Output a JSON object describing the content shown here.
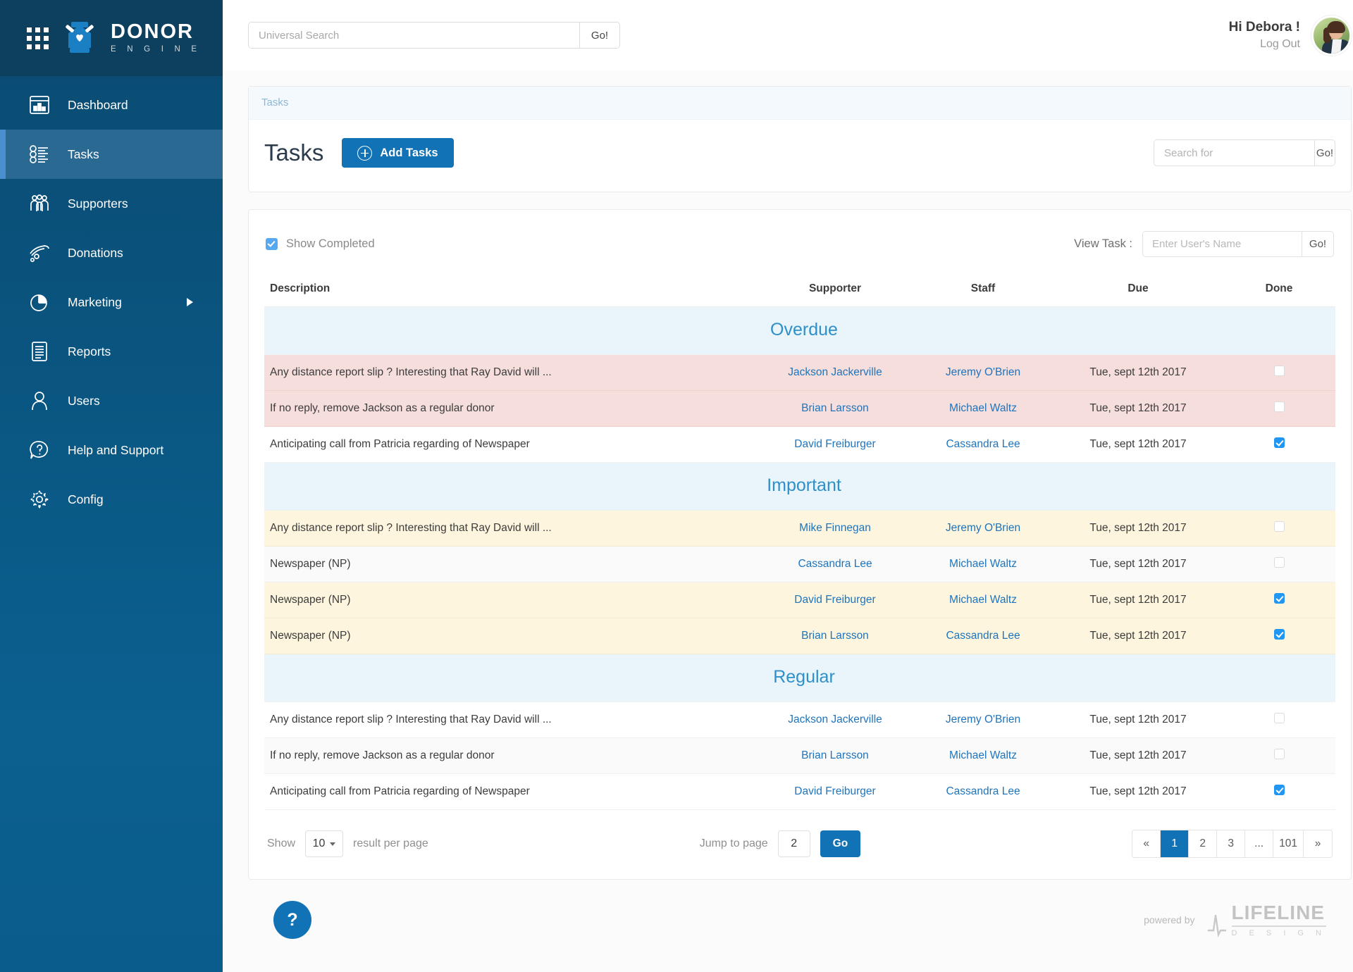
{
  "brand": {
    "name": "DONOR",
    "subtitle": "E N G I N E",
    "grid_icon": "apps-grid-icon",
    "logo_icon": "donor-engine-logo-icon"
  },
  "sidebar": {
    "items": [
      {
        "label": "Dashboard",
        "icon": "dashboard-icon",
        "active": false,
        "arrow": false
      },
      {
        "label": "Tasks",
        "icon": "tasks-list-icon",
        "active": true,
        "arrow": false
      },
      {
        "label": "Supporters",
        "icon": "people-group-icon",
        "active": false,
        "arrow": false
      },
      {
        "label": "Donations",
        "icon": "hand-coin-icon",
        "active": false,
        "arrow": false
      },
      {
        "label": "Marketing",
        "icon": "pie-chart-icon",
        "active": false,
        "arrow": true
      },
      {
        "label": "Reports",
        "icon": "document-lines-icon",
        "active": false,
        "arrow": false
      },
      {
        "label": "Users",
        "icon": "user-person-icon",
        "active": false,
        "arrow": false
      },
      {
        "label": "Help and Support",
        "icon": "question-bubble-icon",
        "active": false,
        "arrow": false
      },
      {
        "label": "Config",
        "icon": "gear-icon",
        "active": false,
        "arrow": false
      }
    ]
  },
  "topbar": {
    "search_placeholder": "Universal Search",
    "search_value": "",
    "go_label": "Go!",
    "greeting": "Hi Debora !",
    "logout_label": "Log Out",
    "avatar_icon": "user-avatar"
  },
  "breadcrumb": {
    "label": "Tasks"
  },
  "tasks_header": {
    "title": "Tasks",
    "add_button_label": "Add Tasks",
    "add_icon": "plus-circle-icon",
    "search_placeholder": "Search for",
    "search_value": "",
    "search_go_label": "Go!"
  },
  "filters": {
    "show_completed_label": "Show Completed",
    "show_completed_checked": true,
    "view_task_label": "View Task :",
    "view_task_placeholder": "Enter User's Name",
    "view_task_value": "",
    "view_task_go_label": "Go!"
  },
  "table": {
    "columns": [
      "Description",
      "Supporter",
      "Staff",
      "Due",
      "Done"
    ],
    "groups": [
      {
        "name": "Overdue",
        "rows": [
          {
            "description": "Any distance report slip ? Interesting that Ray David will ...",
            "supporter": "Jackson Jackerville",
            "staff": "Jeremy O'Brien",
            "due": "Tue, sept 12th 2017",
            "done": false,
            "style": "r-overdue"
          },
          {
            "description": "If no reply, remove Jackson as a regular donor",
            "supporter": "Brian Larsson",
            "staff": "Michael Waltz",
            "due": "Tue, sept 12th 2017",
            "done": false,
            "style": "r-overdue"
          },
          {
            "description": "Anticipating call from Patricia regarding of Newspaper",
            "supporter": "David Freiburger",
            "staff": "Cassandra Lee",
            "due": "Tue, sept 12th 2017",
            "done": true,
            "style": "r-white"
          }
        ]
      },
      {
        "name": "Important",
        "rows": [
          {
            "description": "Any distance report slip ? Interesting that Ray David will ...",
            "supporter": "Mike Finnegan",
            "staff": "Jeremy O'Brien",
            "due": "Tue, sept 12th 2017",
            "done": false,
            "style": "r-important"
          },
          {
            "description": "Newspaper (NP)",
            "supporter": "Cassandra Lee",
            "staff": "Michael Waltz",
            "due": "Tue, sept 12th 2017",
            "done": false,
            "style": "r-grey"
          },
          {
            "description": "Newspaper (NP)",
            "supporter": "David Freiburger",
            "staff": "Michael Waltz",
            "due": "Tue, sept 12th 2017",
            "done": true,
            "style": "r-important"
          },
          {
            "description": "Newspaper (NP)",
            "supporter": "Brian Larsson",
            "staff": "Cassandra Lee",
            "due": "Tue, sept 12th 2017",
            "done": true,
            "style": "r-important"
          }
        ]
      },
      {
        "name": "Regular",
        "rows": [
          {
            "description": "Any distance report slip ? Interesting that Ray David will ...",
            "supporter": "Jackson Jackerville",
            "staff": "Jeremy O'Brien",
            "due": "Tue, sept 12th 2017",
            "done": false,
            "style": "r-white"
          },
          {
            "description": "If no reply, remove Jackson as a regular donor",
            "supporter": "Brian Larsson",
            "staff": "Michael Waltz",
            "due": "Tue, sept 12th 2017",
            "done": false,
            "style": "r-grey"
          },
          {
            "description": "Anticipating call from Patricia regarding of Newspaper",
            "supporter": "David Freiburger",
            "staff": "Cassandra Lee",
            "due": "Tue, sept 12th 2017",
            "done": true,
            "style": "r-white"
          }
        ]
      }
    ]
  },
  "pagination": {
    "show_label": "Show",
    "per_page_value": "10",
    "result_per_page_label": "result per page",
    "jump_label": "Jump to page",
    "jump_value": "2",
    "go_label": "Go",
    "pages": [
      {
        "label": "«",
        "active": false
      },
      {
        "label": "1",
        "active": true
      },
      {
        "label": "2",
        "active": false
      },
      {
        "label": "3",
        "active": false
      },
      {
        "label": "...",
        "active": false
      },
      {
        "label": "101",
        "active": false
      },
      {
        "label": "»",
        "active": false
      }
    ]
  },
  "footer": {
    "help_icon": "question-mark-icon",
    "help_label": "?",
    "powered_by": "powered by",
    "vendor_name": "LIFELINE",
    "vendor_sub": "D E S I G N"
  },
  "colors": {
    "accent": "#1272b6",
    "sidebar": "#0a5681",
    "overdue_row": "#f6dedc",
    "important_row": "#fdf5dd",
    "group_header": "#eaf4fb",
    "link": "#1e74bd"
  }
}
